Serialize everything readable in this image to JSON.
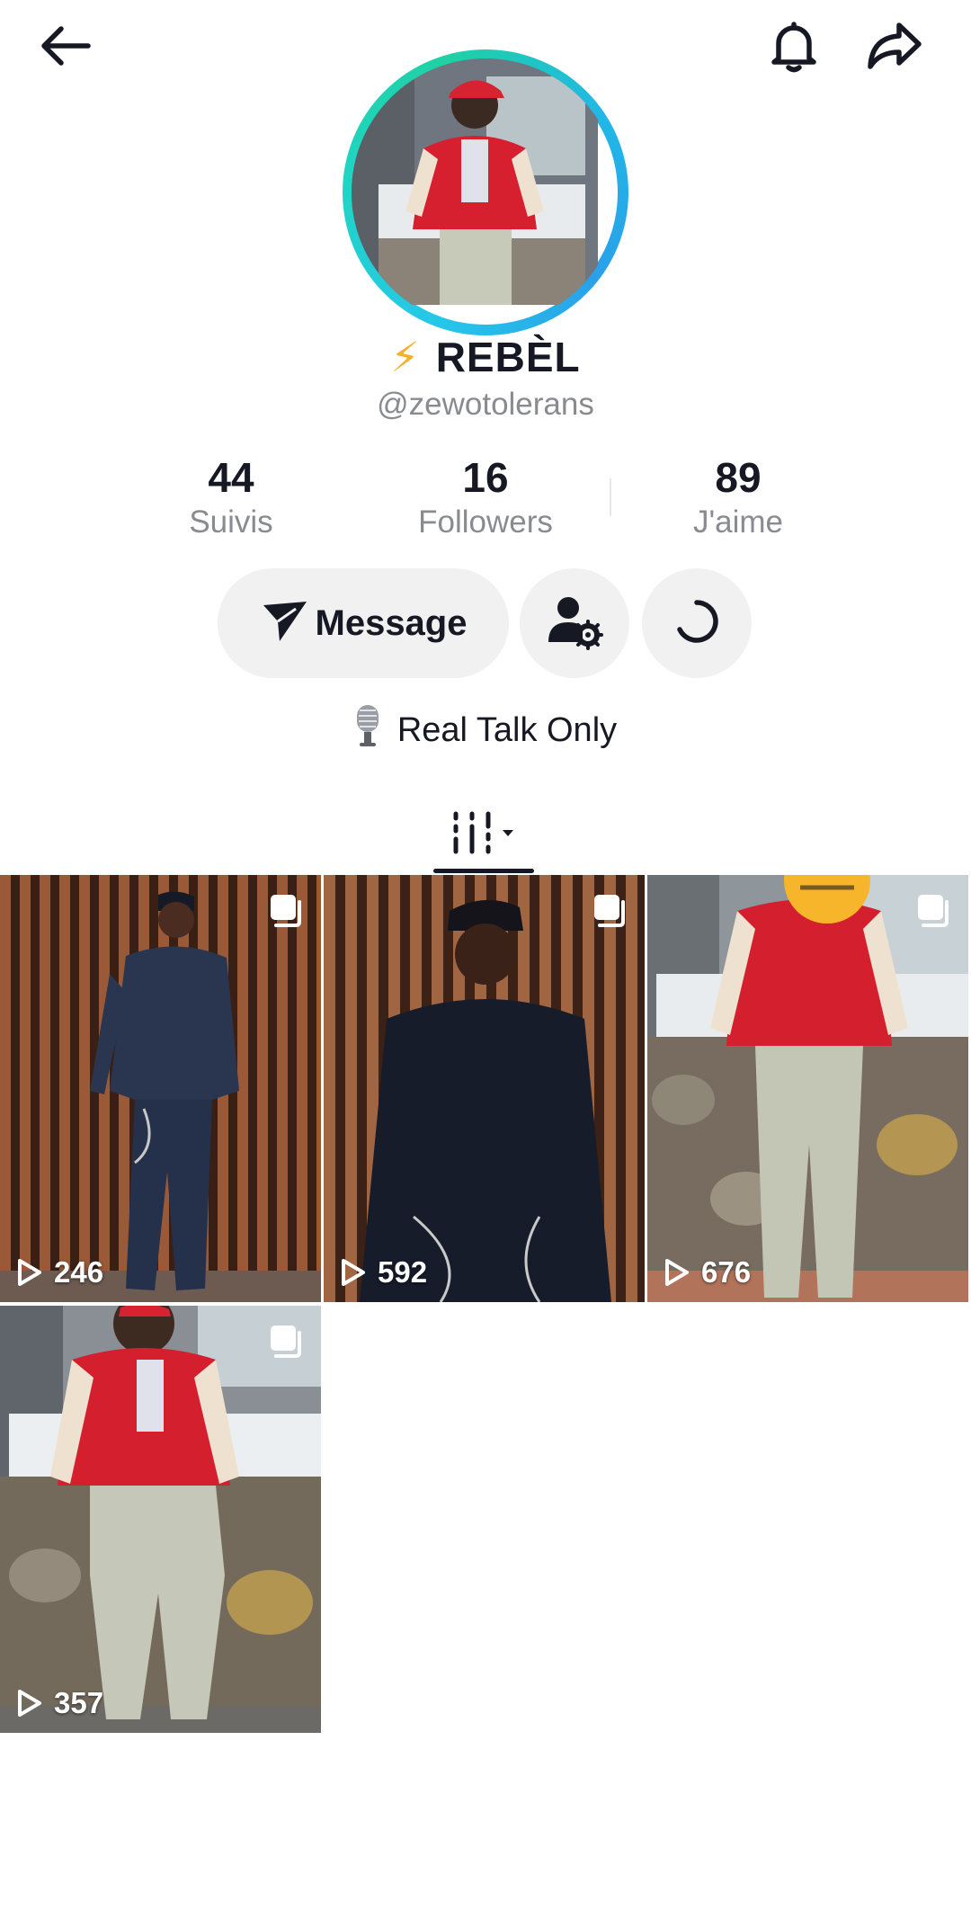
{
  "header": {
    "back_icon": "arrow-left-icon",
    "bell_icon": "bell-icon",
    "share_icon": "share-arrow-icon"
  },
  "profile": {
    "badge": "⚡",
    "display_name": "REBÈL",
    "handle": "@zewotolerans",
    "ring_colors": [
      "#25c7e8",
      "#1fd1a3"
    ]
  },
  "stats": [
    {
      "value": "44",
      "label": "Suivis"
    },
    {
      "value": "16",
      "label": "Followers"
    },
    {
      "value": "89",
      "label": "J'aime"
    }
  ],
  "actions": {
    "message_label": "Message",
    "message_icon": "send-icon",
    "manage_icon": "user-settings-icon",
    "refresh_icon": "loading-spinner-icon"
  },
  "bio": {
    "icon": "microphone-icon",
    "text": "Real Talk Only"
  },
  "tabs": {
    "active_icon": "grid-filter-icon"
  },
  "videos": [
    {
      "views": "246"
    },
    {
      "views": "592"
    },
    {
      "views": "676"
    },
    {
      "views": "357"
    }
  ],
  "colors": {
    "text": "#161823",
    "muted": "#8a8b91",
    "button_bg": "#f1f1f2",
    "bolt": "#f5b12a"
  }
}
